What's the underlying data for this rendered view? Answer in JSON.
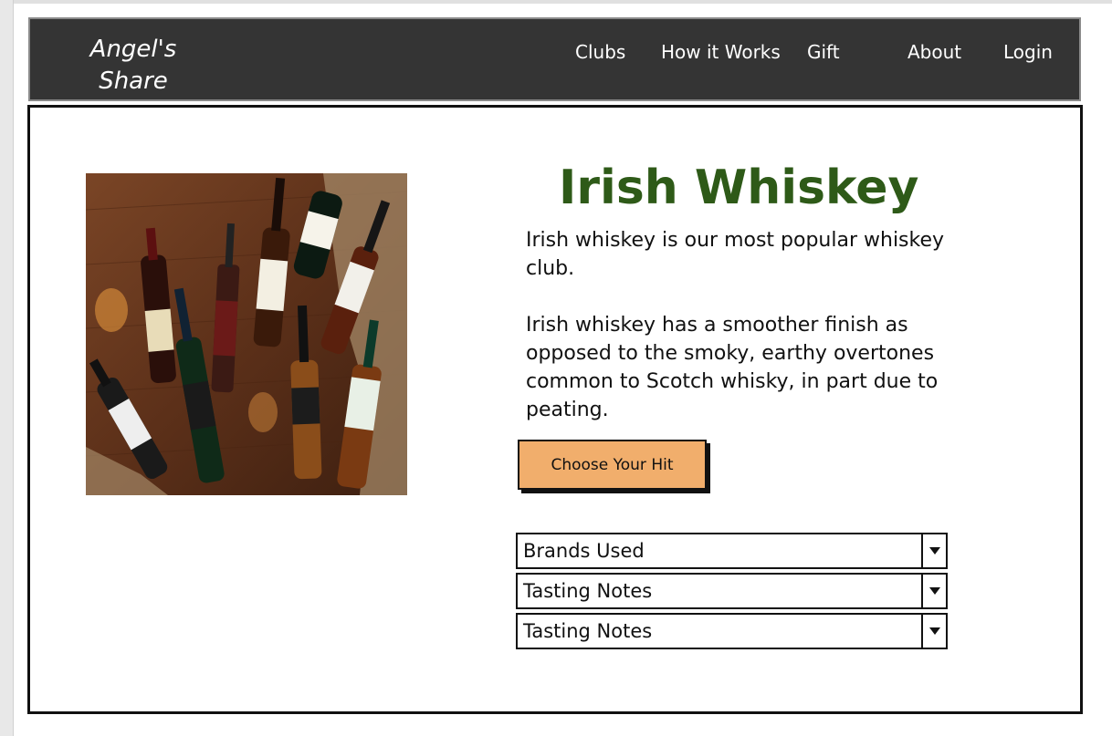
{
  "brand": {
    "line1": "Angel's",
    "line2": "Share"
  },
  "nav": {
    "clubs": "Clubs",
    "how_it_works": "How it Works",
    "gift": "Gift",
    "about": "About",
    "login": "Login"
  },
  "main": {
    "title": "Irish Whiskey",
    "paragraph1": "Irish whiskey is our most popular whiskey club.",
    "paragraph2": "Irish whiskey has a smoother finish as opposed to the smoky, earthy overtones common to Scotch whisky, in part due to peating.",
    "cta_label": "Choose Your Hit"
  },
  "dropdowns": [
    {
      "label": "Brands Used"
    },
    {
      "label": "Tasting Notes"
    },
    {
      "label": "Tasting Notes"
    }
  ],
  "colors": {
    "navbar": "#343434",
    "title": "#2e5a18",
    "cta": "#f1ae6c"
  },
  "icons": {
    "dropdown_arrow": "caret-down-icon"
  }
}
